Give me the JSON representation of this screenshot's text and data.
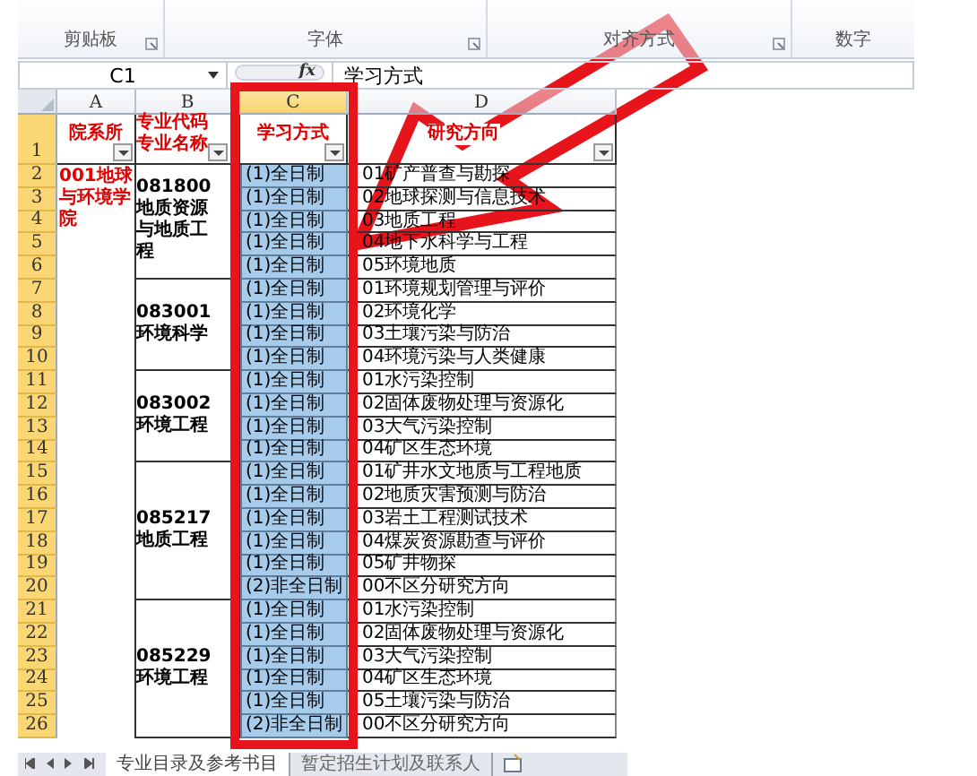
{
  "ribbon": {
    "groups": [
      {
        "label": "剪贴板"
      },
      {
        "label": "字体"
      },
      {
        "label": "对齐方式"
      },
      {
        "label": "数字"
      }
    ]
  },
  "formula_bar": {
    "name_box": "C1",
    "function_button": "fx",
    "formula": "学习方式"
  },
  "sheet": {
    "columns": [
      {
        "label": "A",
        "selected": false
      },
      {
        "label": "B",
        "selected": false
      },
      {
        "label": "C",
        "selected": true
      },
      {
        "label": "D",
        "selected": false
      }
    ],
    "header_row": {
      "number": "1",
      "cells": [
        {
          "text": "院系所",
          "filter": true
        },
        {
          "text": "专业代码专业名称",
          "filter": true
        },
        {
          "text": "学习方式",
          "filter": true
        },
        {
          "text": "研究方向",
          "filter": true
        }
      ]
    },
    "department": "001地球与环境学院",
    "majors": [
      {
        "name": "081800地质资源与地质工程",
        "rows": [
          {
            "number": "2",
            "study_mode": "(1)全日制",
            "direction": "01矿产普查与勘探"
          },
          {
            "number": "3",
            "study_mode": "(1)全日制",
            "direction": "02地球探测与信息技术"
          },
          {
            "number": "4",
            "study_mode": "(1)全日制",
            "direction": "03地质工程"
          },
          {
            "number": "5",
            "study_mode": "(1)全日制",
            "direction": "04地下水科学与工程"
          },
          {
            "number": "6",
            "study_mode": "(1)全日制",
            "direction": "05环境地质"
          }
        ]
      },
      {
        "name": "083001环境科学",
        "rows": [
          {
            "number": "7",
            "study_mode": "(1)全日制",
            "direction": "01环境规划管理与评价"
          },
          {
            "number": "8",
            "study_mode": "(1)全日制",
            "direction": "02环境化学"
          },
          {
            "number": "9",
            "study_mode": "(1)全日制",
            "direction": "03土壤污染与防治"
          },
          {
            "number": "10",
            "study_mode": "(1)全日制",
            "direction": "04环境污染与人类健康"
          }
        ]
      },
      {
        "name": "083002环境工程",
        "rows": [
          {
            "number": "11",
            "study_mode": "(1)全日制",
            "direction": "01水污染控制"
          },
          {
            "number": "12",
            "study_mode": "(1)全日制",
            "direction": "02固体废物处理与资源化"
          },
          {
            "number": "13",
            "study_mode": "(1)全日制",
            "direction": "03大气污染控制"
          },
          {
            "number": "14",
            "study_mode": "(1)全日制",
            "direction": "04矿区生态环境"
          }
        ]
      },
      {
        "name": "085217地质工程",
        "rows": [
          {
            "number": "15",
            "study_mode": "(1)全日制",
            "direction": "01矿井水文地质与工程地质"
          },
          {
            "number": "16",
            "study_mode": "(1)全日制",
            "direction": "02地质灾害预测与防治"
          },
          {
            "number": "17",
            "study_mode": "(1)全日制",
            "direction": "03岩土工程测试技术"
          },
          {
            "number": "18",
            "study_mode": "(1)全日制",
            "direction": "04煤炭资源勘查与评价"
          },
          {
            "number": "19",
            "study_mode": "(1)全日制",
            "direction": "05矿井物探"
          },
          {
            "number": "20",
            "study_mode": "(2)非全日制",
            "direction": "00不区分研究方向"
          }
        ]
      },
      {
        "name": "085229环境工程",
        "rows": [
          {
            "number": "21",
            "study_mode": "(1)全日制",
            "direction": "01水污染控制"
          },
          {
            "number": "22",
            "study_mode": "(1)全日制",
            "direction": "02固体废物处理与资源化"
          },
          {
            "number": "23",
            "study_mode": "(1)全日制",
            "direction": "03大气污染控制"
          },
          {
            "number": "24",
            "study_mode": "(1)全日制",
            "direction": "04矿区生态环境"
          },
          {
            "number": "25",
            "study_mode": "(1)全日制",
            "direction": "05土壤污染与防治"
          },
          {
            "number": "26",
            "study_mode": "(2)非全日制",
            "direction": "00不区分研究方向"
          }
        ]
      }
    ]
  },
  "sheet_tabs": [
    {
      "label": "专业目录及参考书目",
      "selected": true
    },
    {
      "label": "暂定招生计划及联系人",
      "selected": false
    }
  ],
  "annotations": {
    "highlight_frame": true,
    "arrow": true
  }
}
